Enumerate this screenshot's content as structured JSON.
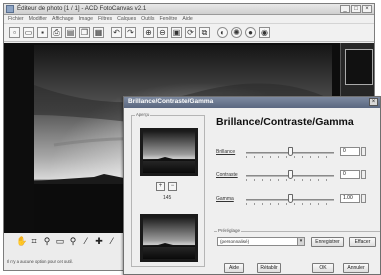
{
  "window": {
    "title": "Éditeur de photo [1 / 1] - ACD FotoCanvas v2.1",
    "menu": [
      "Fichier",
      "Modifier",
      "Affichage",
      "Image",
      "Filtres",
      "Calques",
      "Outils",
      "Fenêtre",
      "Aide"
    ],
    "controls": {
      "minimize": "_",
      "maximize": "□",
      "close": "×"
    }
  },
  "status": {
    "text": "Il n'y a aucune option pour cet outil."
  },
  "dialog": {
    "title": "Brillance/Contraste/Gamma",
    "heading": "Brillance/Contraste/Gamma",
    "preview_label": "Aperçu",
    "zoom_in": "+",
    "zoom_out": "−",
    "zoom_value": "145",
    "close": "×",
    "sliders": [
      {
        "label": "Brillance",
        "value": "0",
        "level": 0.5
      },
      {
        "label": "Contraste",
        "value": "0",
        "level": 0.5
      },
      {
        "label": "Gamma",
        "value": "1.00",
        "level": 0.5
      }
    ],
    "preset_label": "Préréglage",
    "preset_value": "(personnalisé)",
    "buttons": {
      "save": "Enregistrer",
      "delete": "Effacer",
      "help": "Aide",
      "reset": "Rétablir",
      "ok": "OK",
      "cancel": "Annuler"
    }
  },
  "colors": {
    "dialog_title_bar": "#5a6780",
    "workspace": "#0d0d0d"
  }
}
